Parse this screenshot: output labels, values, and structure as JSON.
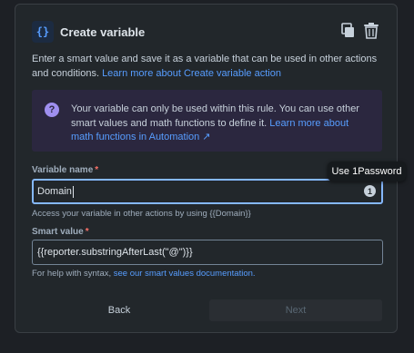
{
  "dialog": {
    "icon_text": "{}",
    "title": "Create variable",
    "actions": {
      "duplicate_icon": "copy-icon",
      "delete_icon": "trash-icon"
    }
  },
  "description": {
    "text": "Enter a smart value and save it as a variable that can be used in other actions and conditions.",
    "link": "Learn more about Create variable action"
  },
  "info": {
    "icon": "question-icon",
    "text": "Your variable can only be used within this rule. You can use other smart values and math functions to define it.",
    "link": "Learn more about math functions in Automation ↗"
  },
  "variable_name": {
    "label": "Variable name",
    "required_mark": "*",
    "value": "Domain",
    "helper": "Access your variable in other actions by using {{Domain}}"
  },
  "smart_value": {
    "label": "Smart value",
    "required_mark": "*",
    "value": "{{reporter.substringAfterLast(\"@\")}}",
    "helper_text": "For help with syntax,",
    "helper_link": "see our smart values documentation."
  },
  "tooltip": {
    "text": "Use 1Password"
  },
  "buttons": {
    "back": "Back",
    "next": "Next"
  },
  "colors": {
    "accent": "#579dff",
    "info_bg": "#2b273f",
    "focus": "#85b8ff",
    "required": "#f87168"
  }
}
